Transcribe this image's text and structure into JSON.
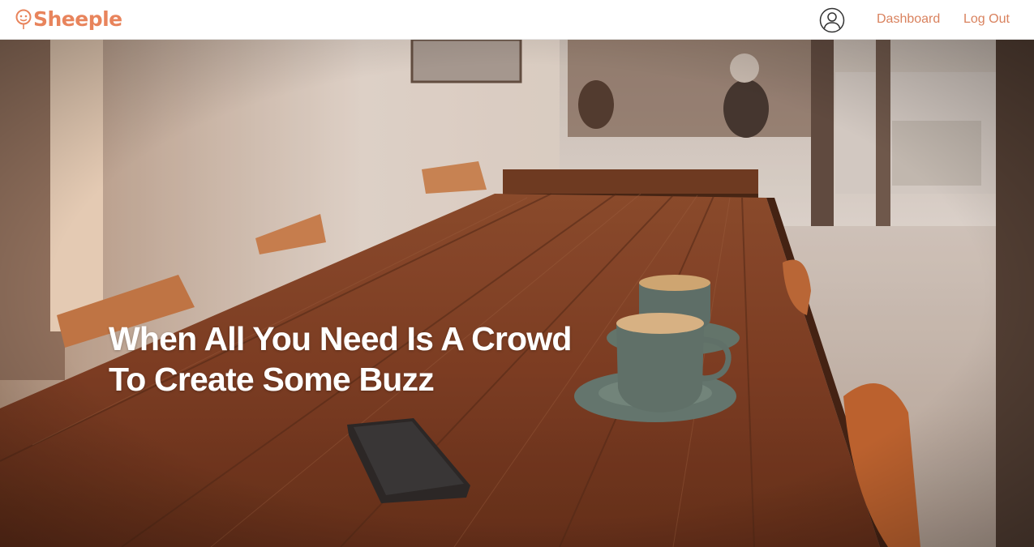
{
  "brand": {
    "name": "Sheeple",
    "logo_icon": "sheep-balloon-icon",
    "color": "#e8845c"
  },
  "nav": {
    "profile_icon": "user-circle-icon",
    "links": [
      {
        "label": "Dashboard"
      },
      {
        "label": "Log Out"
      }
    ],
    "link_color": "#d9825e"
  },
  "hero": {
    "headline_line1": "When All You Need Is A Crowd",
    "headline_line2": "To Create Some Buzz",
    "background": "cafe-table-with-coffee-cups-photo"
  }
}
